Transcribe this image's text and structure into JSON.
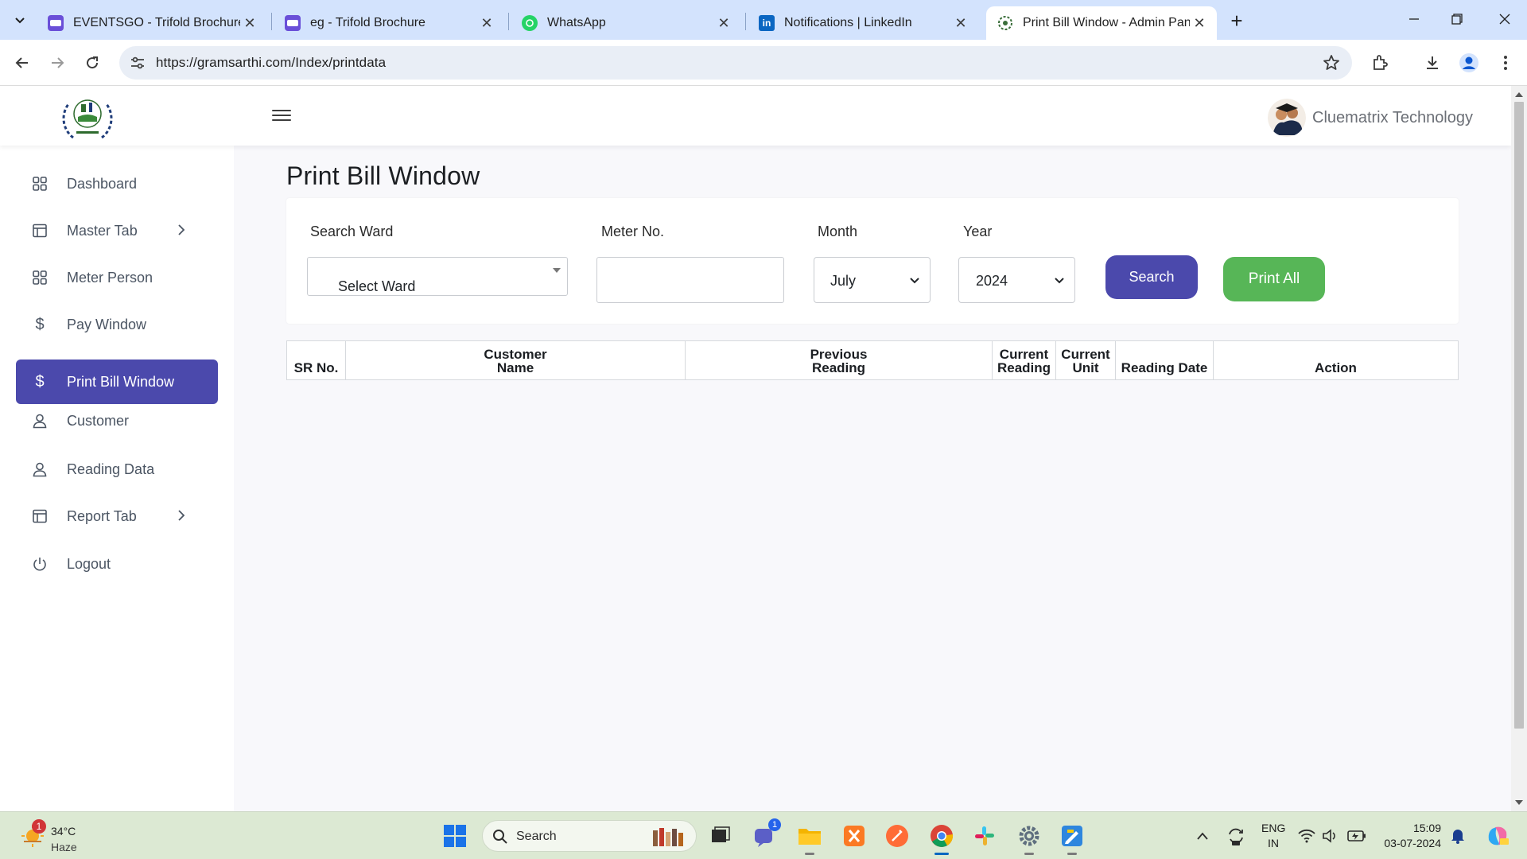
{
  "browser": {
    "tabs": [
      {
        "title": "EVENTSGO - Trifold Brochure",
        "favicon_color": "#6a4fd8"
      },
      {
        "title": "eg - Trifold Brochure",
        "favicon_color": "#6a4fd8"
      },
      {
        "title": "WhatsApp",
        "favicon_color": "#25d366"
      },
      {
        "title": "Notifications | LinkedIn",
        "favicon_color": "#0a66c2"
      },
      {
        "title": "Print Bill Window - Admin Panel",
        "favicon_color": "#3a6e3a",
        "active": true
      }
    ],
    "url": "https://gramsarthi.com/Index/printdata"
  },
  "header": {
    "logo_icon": "gramsarthi-emblem-logo",
    "menu_icon": "hamburger-menu-icon",
    "profile_name": "Cluematrix Technology"
  },
  "sidebar": {
    "items": [
      {
        "label": "Dashboard",
        "icon": "grid-icon"
      },
      {
        "label": "Master Tab",
        "icon": "layout-icon",
        "has_submenu": true
      },
      {
        "label": "Meter Person",
        "icon": "grid-icon"
      },
      {
        "label": "Pay Window",
        "icon": "dollar-icon"
      },
      {
        "label": "Print Bill Window",
        "icon": "dollar-icon",
        "active": true
      },
      {
        "label": "Customer",
        "icon": "user-icon"
      },
      {
        "label": "Reading Data",
        "icon": "user-icon"
      },
      {
        "label": "Report Tab",
        "icon": "layout-icon",
        "has_submenu": true
      },
      {
        "label": "Logout",
        "icon": "power-icon"
      }
    ]
  },
  "main": {
    "title": "Print Bill Window",
    "filters": {
      "ward_label": "Search Ward",
      "ward_value": "Select Ward",
      "meter_label": "Meter No.",
      "meter_value": "",
      "month_label": "Month",
      "month_value": "July",
      "year_label": "Year",
      "year_value": "2024",
      "search_button": "Search",
      "print_all_button": "Print All"
    },
    "table": {
      "columns": [
        {
          "line1": "",
          "line2": "SR No."
        },
        {
          "line1": "Customer",
          "line2": "Name"
        },
        {
          "line1": "Previous",
          "line2": "Reading"
        },
        {
          "line1": "Current",
          "line2": "Reading"
        },
        {
          "line1": "Current",
          "line2": "Unit"
        },
        {
          "line1": "",
          "line2": "Reading Date"
        },
        {
          "line1": "",
          "line2": "Action"
        }
      ],
      "rows": []
    }
  },
  "colors": {
    "accent": "#4b49ac",
    "print_button": "#57b657",
    "taskbar": "#dce9d3"
  },
  "taskbar": {
    "weather_badge": "1",
    "temperature": "34°C",
    "condition": "Haze",
    "search_label": "Search",
    "teams_badge": "1",
    "language_line1": "ENG",
    "language_line2": "IN",
    "time": "15:09",
    "date": "03-07-2024"
  }
}
